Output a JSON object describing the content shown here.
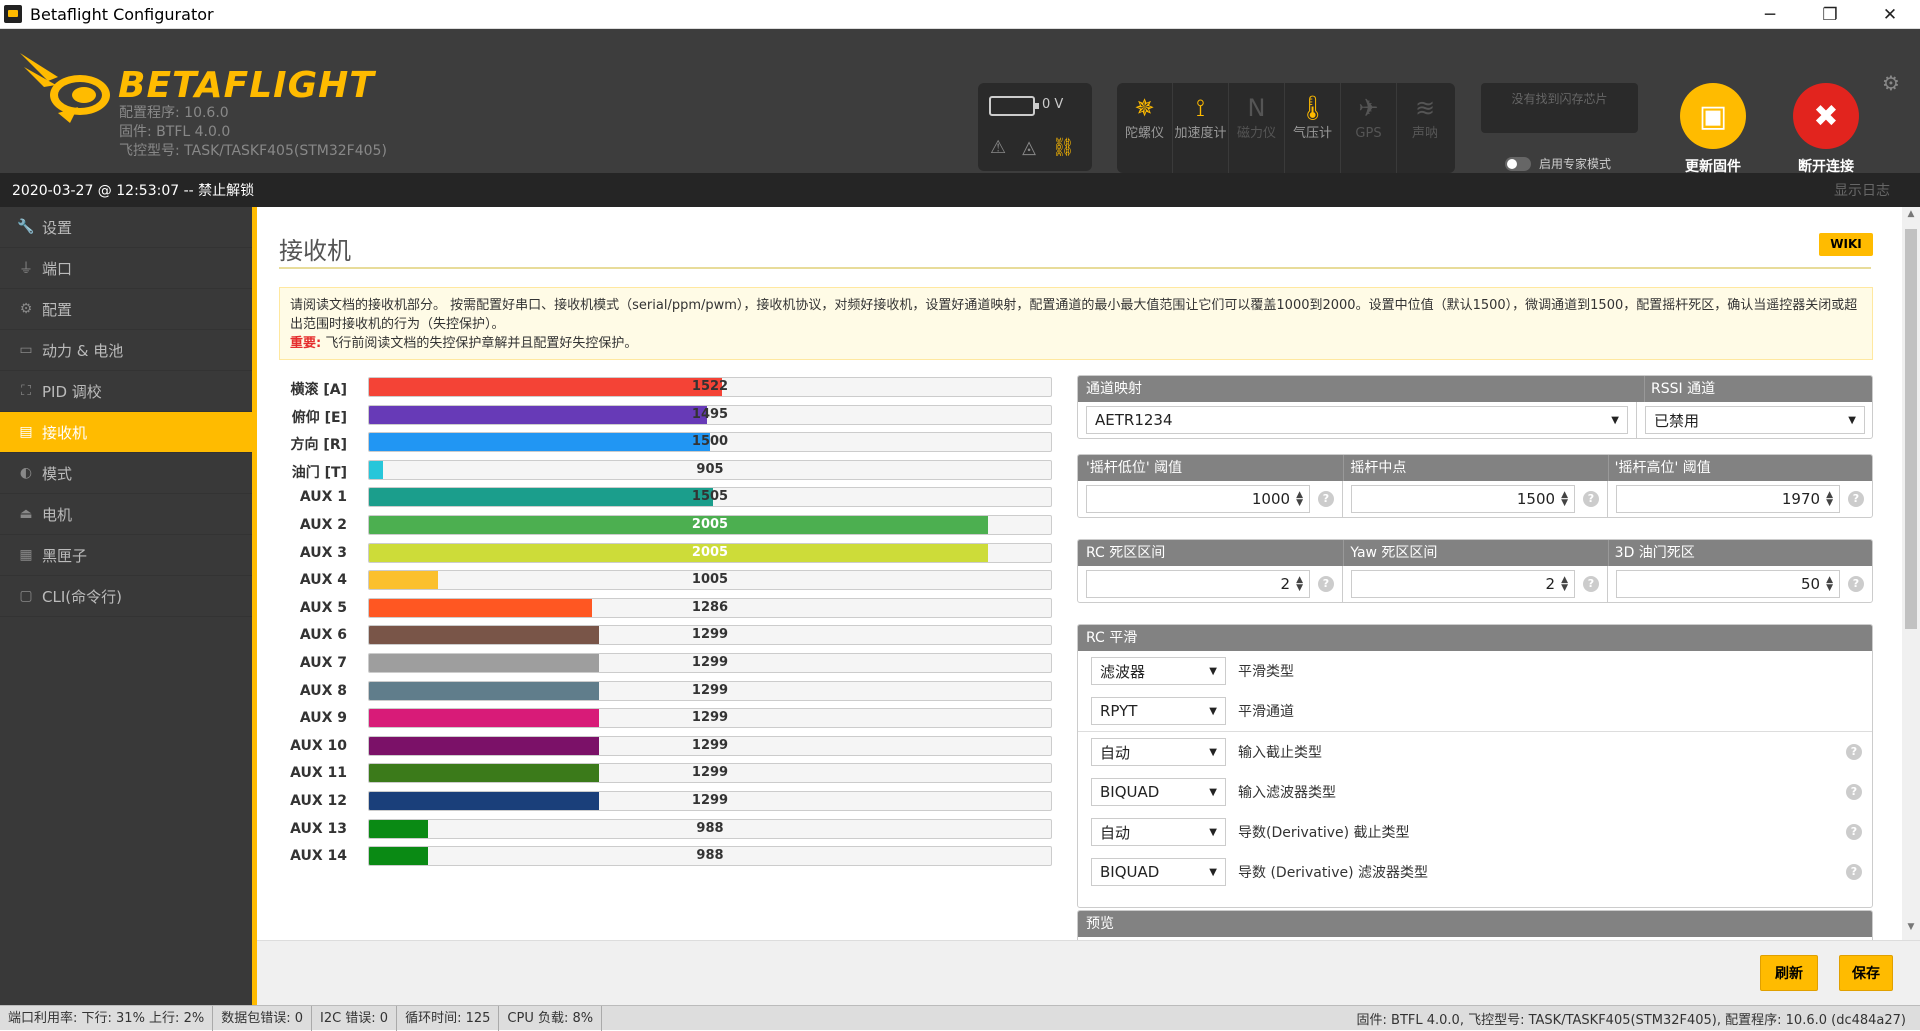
{
  "window": {
    "title": "Betaflight Configurator",
    "minimize": "─",
    "maximize": "❐",
    "close": "✕"
  },
  "header": {
    "brand": "BETAFLIGHT",
    "configurator_version": "配置程序: 10.6.0",
    "firmware": "固件: BTFL 4.0.0",
    "board": "飞控型号: TASK/TASKF405(STM32F405)",
    "battery_voltage": "0 V",
    "sensors": [
      {
        "icon": "gyro-icon",
        "label": "陀螺仪",
        "active": true
      },
      {
        "icon": "accelerometer-icon",
        "label": "加速度计",
        "active": true
      },
      {
        "icon": "magnetometer-icon",
        "label": "磁力仪",
        "active": false
      },
      {
        "icon": "barometer-icon",
        "label": "气压计",
        "active": true
      },
      {
        "icon": "gps-icon",
        "label": "GPS",
        "active": false
      },
      {
        "icon": "sonar-icon",
        "label": "声呐",
        "active": false
      }
    ],
    "dataflash": "没有找到闪存芯片",
    "expert_mode": "启用专家模式",
    "update_firmware": "更新固件",
    "disconnect": "断开连接",
    "update_color": "#ffbb00",
    "disconnect_color": "#e2241e"
  },
  "status": {
    "timestamp": "2020-03-27 @ 12:53:07 -- 禁止解锁",
    "log_toggle": "显示日志"
  },
  "sidebar": {
    "items": [
      {
        "icon": "wrench-icon",
        "label": "设置",
        "active": false
      },
      {
        "icon": "plug-icon",
        "label": "端口",
        "active": false
      },
      {
        "icon": "gear-icon",
        "label": "配置",
        "active": false
      },
      {
        "icon": "battery-icon",
        "label": "动力 & 电池",
        "active": false
      },
      {
        "icon": "sitemap-icon",
        "label": "PID 调校",
        "active": false
      },
      {
        "icon": "receiver-icon",
        "label": "接收机",
        "active": true
      },
      {
        "icon": "toggle-icon",
        "label": "模式",
        "active": false
      },
      {
        "icon": "motor-icon",
        "label": "电机",
        "active": false
      },
      {
        "icon": "blackbox-icon",
        "label": "黑匣子",
        "active": false
      },
      {
        "icon": "terminal-icon",
        "label": "CLI(命令行)",
        "active": false
      }
    ]
  },
  "main": {
    "title": "接收机",
    "wiki": "WIKI",
    "notice": "请阅读文档的接收机部分。 按需配置好串口、接收机模式（serial/ppm/pwm），接收机协议，对频好接收机，设置好通道映射，配置通道的最小最大值范围让它们可以覆盖1000到2000。设置中位值（默认1500），微调通道到1500，配置摇杆死区，确认当遥控器关闭或超出范围时接收机的行为（失控保护）。",
    "important_label": "重要:",
    "important_text": " 飞行前阅读文档的失控保护章解并且配置好失控保护。",
    "channels": [
      {
        "name": "横滚 [A]",
        "value": 1522,
        "color": "#f44336"
      },
      {
        "name": "俯仰 [E]",
        "value": 1495,
        "color": "#673ab7"
      },
      {
        "name": "方向 [R]",
        "value": 1500,
        "color": "#2196f3"
      },
      {
        "name": "油门 [T]",
        "value": 905,
        "color": "#26c6da"
      },
      {
        "name": "AUX 1",
        "value": 1505,
        "color": "#1b9e8c"
      },
      {
        "name": "AUX 2",
        "value": 2005,
        "color": "#4caf50"
      },
      {
        "name": "AUX 3",
        "value": 2005,
        "color": "#cddc39"
      },
      {
        "name": "AUX 4",
        "value": 1005,
        "color": "#fbc02d"
      },
      {
        "name": "AUX 5",
        "value": 1286,
        "color": "#ff5722"
      },
      {
        "name": "AUX 6",
        "value": 1299,
        "color": "#795548"
      },
      {
        "name": "AUX 7",
        "value": 1299,
        "color": "#9e9e9e"
      },
      {
        "name": "AUX 8",
        "value": 1299,
        "color": "#607d8b"
      },
      {
        "name": "AUX 9",
        "value": 1299,
        "color": "#d81b78"
      },
      {
        "name": "AUX 10",
        "value": 1299,
        "color": "#7b1168"
      },
      {
        "name": "AUX 11",
        "value": 1299,
        "color": "#3b7a1a"
      },
      {
        "name": "AUX 12",
        "value": 1299,
        "color": "#1a3f7a"
      },
      {
        "name": "AUX 13",
        "value": 988,
        "color": "#0a8a14"
      },
      {
        "name": "AUX 14",
        "value": 988,
        "color": "#0a8a14"
      }
    ],
    "channel_range": [
      880,
      2120
    ],
    "mapping": {
      "header": "通道映射",
      "value": "AETR1234"
    },
    "rssi": {
      "header": "RSSI 通道",
      "value": "已禁用"
    },
    "stick": {
      "low_header": "'摇杆低位' 阈值",
      "low": "1000",
      "center_header": "摇杆中点",
      "center": "1500",
      "high_header": "'摇杆高位' 阈值",
      "high": "1970"
    },
    "deadband": {
      "rc_header": "RC 死区区间",
      "rc": "2",
      "yaw_header": "Yaw 死区区间",
      "yaw": "2",
      "throttle3d_header": "3D 油门死区",
      "throttle3d": "50"
    },
    "smoothing": {
      "header": "RC 平滑",
      "rows": [
        {
          "value": "滤波器",
          "label": "平滑类型"
        },
        {
          "value": "RPYT",
          "label": "平滑通道"
        },
        {
          "value": "自动",
          "label": "输入截止类型"
        },
        {
          "value": "BIQUAD",
          "label": "输入滤波器类型"
        },
        {
          "value": "自动",
          "label": "导数(Derivative) 截止类型"
        },
        {
          "value": "BIQUAD",
          "label": "导数 (Derivative) 滤波器类型"
        }
      ]
    },
    "preview_header": "预览",
    "refresh": "刷新",
    "save": "保存"
  },
  "bottom": {
    "port_usage": "端口利用率:  下行: 31% 上行: 2%",
    "packet_errors": "数据包错误: 0",
    "i2c_errors": "I2C 错误: 0",
    "cycle_time": "循环时间: 125",
    "cpu_load": "CPU 负载: 8%",
    "firmware_info": "固件: BTFL 4.0.0, 飞控型号: TASK/TASKF405(STM32F405), 配置程序: 10.6.0 (dc484a27)"
  }
}
